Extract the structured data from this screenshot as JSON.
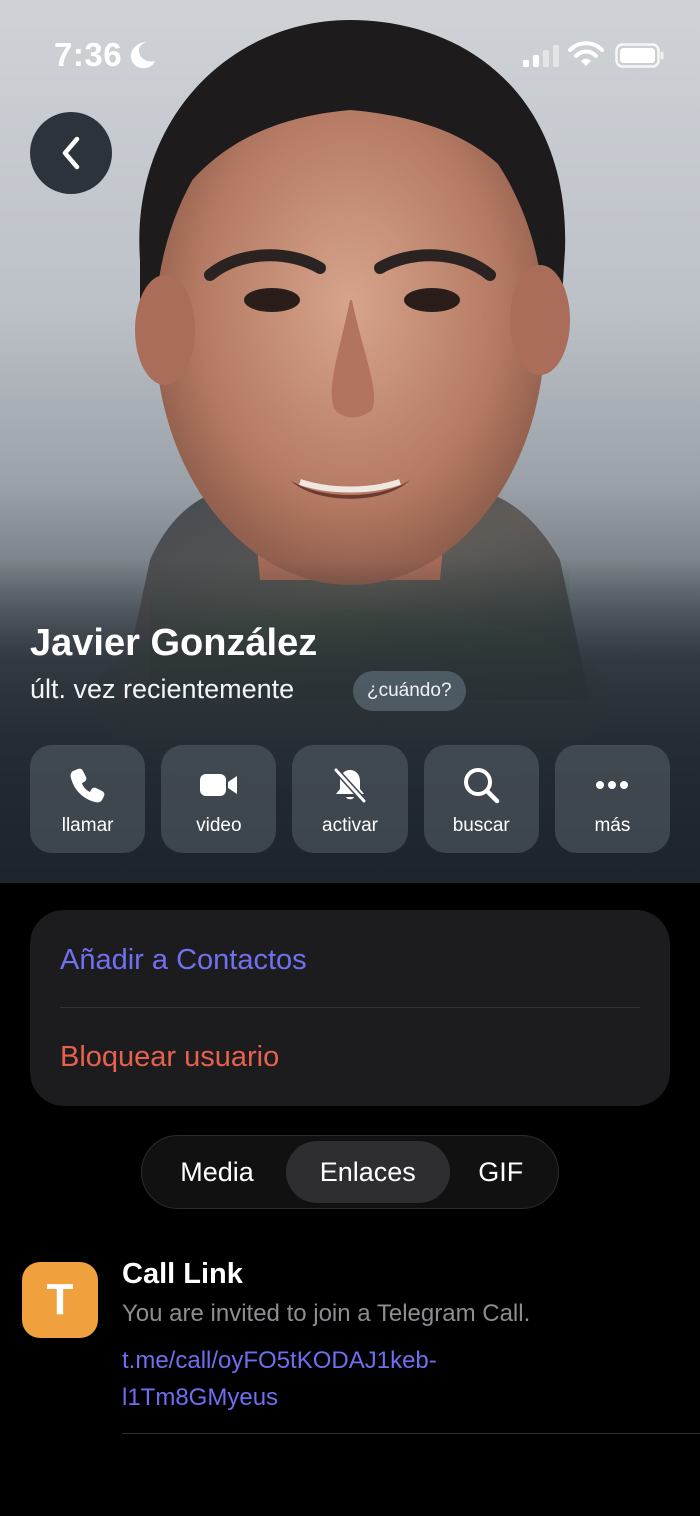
{
  "status_bar": {
    "time": "7:36",
    "icons": [
      "moon-icon",
      "signal-icon",
      "wifi-icon",
      "battery-icon"
    ]
  },
  "profile": {
    "name": "Javier González",
    "last_seen": "últ. vez recientemente",
    "when_button": "¿cuándo?"
  },
  "actions": [
    {
      "label": "llamar",
      "icon": "phone-icon"
    },
    {
      "label": "video",
      "icon": "video-camera-icon"
    },
    {
      "label": "activar",
      "icon": "bell-muted-icon"
    },
    {
      "label": "buscar",
      "icon": "search-icon"
    },
    {
      "label": "más",
      "icon": "more-icon"
    }
  ],
  "options": {
    "add_contact": "Añadir a Contactos",
    "block_user": "Bloquear usuario"
  },
  "tabs": {
    "items": [
      "Media",
      "Enlaces",
      "GIF"
    ],
    "selected": "Enlaces"
  },
  "links": [
    {
      "icon_letter": "T",
      "title": "Call Link",
      "description": "You are invited to join a Telegram Call.",
      "url_line1": "t.me/call/oyFO5tKODAJ1keb-",
      "url_line2": "l1Tm8GMyeus"
    }
  ],
  "colors": {
    "accent": "#7070f0",
    "destructive": "#e8604e",
    "link_icon": "#f0a03c",
    "card": "#1c1c1e"
  }
}
